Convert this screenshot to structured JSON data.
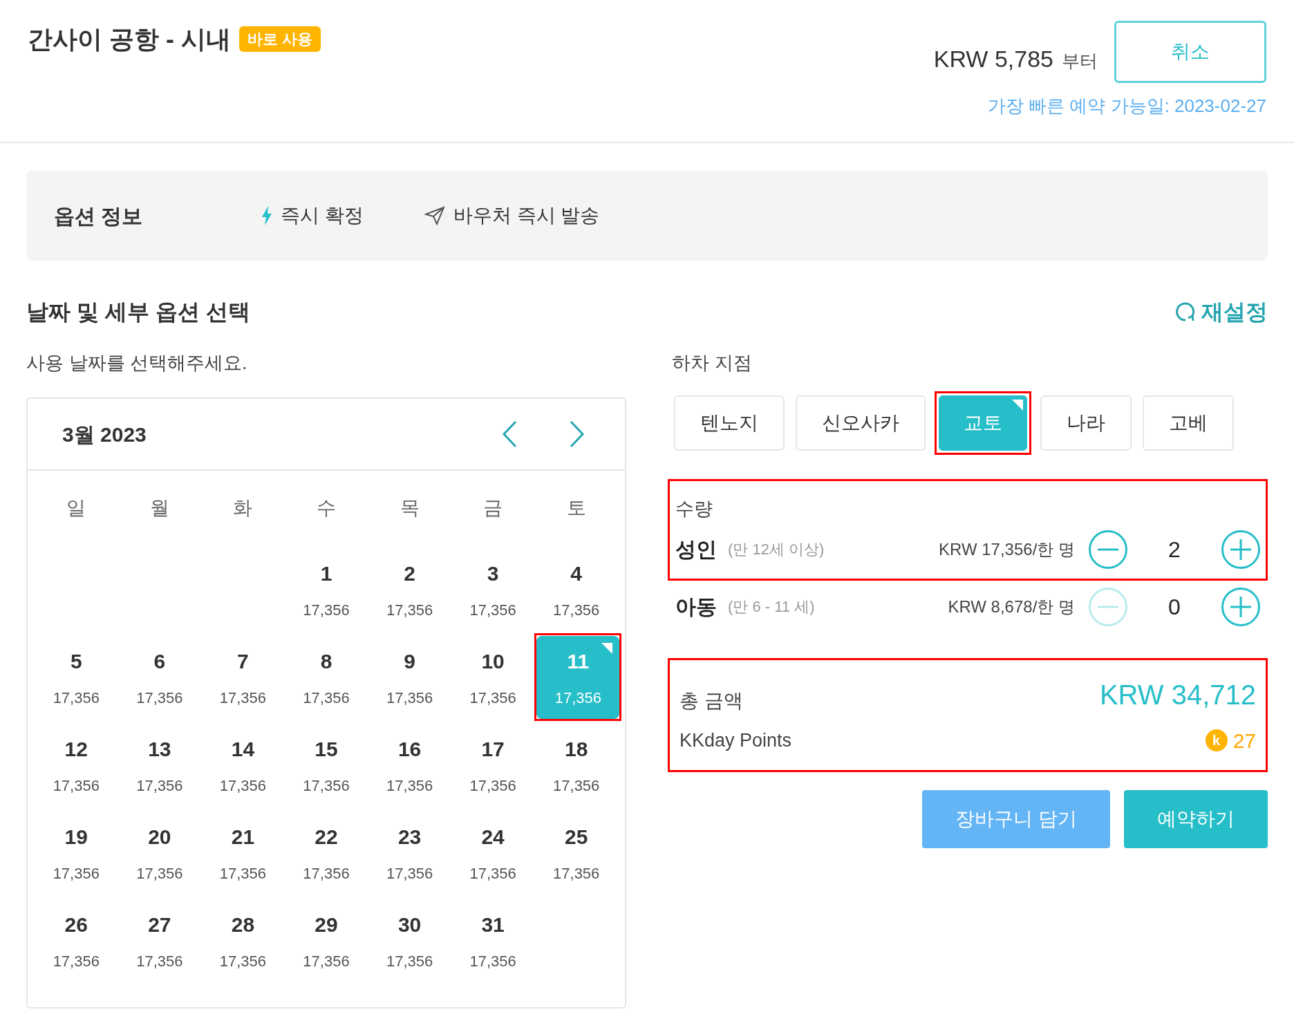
{
  "header": {
    "title": "간사이 공항 - 시내",
    "badge": "바로 사용",
    "price": "KRW 5,785",
    "price_suffix": "부터",
    "cancel_button": "취소",
    "earliest_date": "가장 빠른 예약 가능일: 2023-02-27"
  },
  "option_info": {
    "title": "옵션 정보",
    "features": [
      {
        "kind": "bolt",
        "label": "즉시 확정"
      },
      {
        "kind": "send",
        "label": "바우처 즉시 발송"
      }
    ]
  },
  "section": {
    "title": "날짜 및 세부 옵션 선택",
    "reset": "재설정"
  },
  "calendar": {
    "prompt": "사용 날짜를 선택해주세요.",
    "month": "3월 2023",
    "weekdays": [
      "일",
      "월",
      "화",
      "수",
      "목",
      "금",
      "토"
    ],
    "weeks": [
      {
        "kind": "first_week",
        "days": [
          {
            "day": "1",
            "price": "17,356",
            "selected": false,
            "highlighted": false
          },
          {
            "day": "2",
            "price": "17,356",
            "selected": false,
            "highlighted": false
          },
          {
            "day": "3",
            "price": "17,356",
            "selected": false,
            "highlighted": false
          },
          {
            "day": "4",
            "price": "17,356",
            "selected": false,
            "highlighted": false
          }
        ]
      },
      {
        "kind": "week",
        "days": [
          {
            "day": "5",
            "price": "17,356",
            "selected": false,
            "highlighted": false
          },
          {
            "day": "6",
            "price": "17,356",
            "selected": false,
            "highlighted": false
          },
          {
            "day": "7",
            "price": "17,356",
            "selected": false,
            "highlighted": false
          },
          {
            "day": "8",
            "price": "17,356",
            "selected": false,
            "highlighted": false
          },
          {
            "day": "9",
            "price": "17,356",
            "selected": false,
            "highlighted": false
          },
          {
            "day": "10",
            "price": "17,356",
            "selected": false,
            "highlighted": false
          },
          {
            "day": "11",
            "price": "17,356",
            "selected": true,
            "highlighted": true
          }
        ]
      },
      {
        "kind": "week",
        "days": [
          {
            "day": "12",
            "price": "17,356",
            "selected": false,
            "highlighted": false
          },
          {
            "day": "13",
            "price": "17,356",
            "selected": false,
            "highlighted": false
          },
          {
            "day": "14",
            "price": "17,356",
            "selected": false,
            "highlighted": false
          },
          {
            "day": "15",
            "price": "17,356",
            "selected": false,
            "highlighted": false
          },
          {
            "day": "16",
            "price": "17,356",
            "selected": false,
            "highlighted": false
          },
          {
            "day": "17",
            "price": "17,356",
            "selected": false,
            "highlighted": false
          },
          {
            "day": "18",
            "price": "17,356",
            "selected": false,
            "highlighted": false
          }
        ]
      },
      {
        "kind": "week",
        "days": [
          {
            "day": "19",
            "price": "17,356",
            "selected": false,
            "highlighted": false
          },
          {
            "day": "20",
            "price": "17,356",
            "selected": false,
            "highlighted": false
          },
          {
            "day": "21",
            "price": "17,356",
            "selected": false,
            "highlighted": false
          },
          {
            "day": "22",
            "price": "17,356",
            "selected": false,
            "highlighted": false
          },
          {
            "day": "23",
            "price": "17,356",
            "selected": false,
            "highlighted": false
          },
          {
            "day": "24",
            "price": "17,356",
            "selected": false,
            "highlighted": false
          },
          {
            "day": "25",
            "price": "17,356",
            "selected": false,
            "highlighted": false
          }
        ]
      },
      {
        "kind": "week",
        "days": [
          {
            "day": "26",
            "price": "17,356",
            "selected": false,
            "highlighted": false
          },
          {
            "day": "27",
            "price": "17,356",
            "selected": false,
            "highlighted": false
          },
          {
            "day": "28",
            "price": "17,356",
            "selected": false,
            "highlighted": false
          },
          {
            "day": "29",
            "price": "17,356",
            "selected": false,
            "highlighted": false
          },
          {
            "day": "30",
            "price": "17,356",
            "selected": false,
            "highlighted": false
          },
          {
            "day": "31",
            "price": "17,356",
            "selected": false,
            "highlighted": false
          }
        ]
      }
    ]
  },
  "dropoff": {
    "title": "하차 지점",
    "options": [
      {
        "label": "텐노지",
        "selected": false,
        "highlighted": false
      },
      {
        "label": "신오사카",
        "selected": false,
        "highlighted": false
      },
      {
        "label": "교토",
        "selected": true,
        "highlighted": true
      },
      {
        "label": "나라",
        "selected": false,
        "highlighted": false
      },
      {
        "label": "고베",
        "selected": false,
        "highlighted": false
      }
    ]
  },
  "quantity": {
    "title": "수량",
    "highlighted": true,
    "rows": [
      {
        "label": "성인",
        "note": "(만 12세 이상)",
        "price": "KRW 17,356/한 명",
        "count": "2",
        "minus_disabled": false
      },
      {
        "label": "아동",
        "note": "(만 6 - 11 세)",
        "price": "KRW 8,678/한 명",
        "count": "0",
        "minus_disabled": true
      }
    ]
  },
  "total": {
    "highlighted": true,
    "label": "총 금액",
    "amount": "KRW 34,712",
    "points_label": "KKday Points",
    "coin_letter": "k",
    "points": "27"
  },
  "actions": {
    "cart_button": "장바구니 담기",
    "book_button": "예약하기"
  }
}
